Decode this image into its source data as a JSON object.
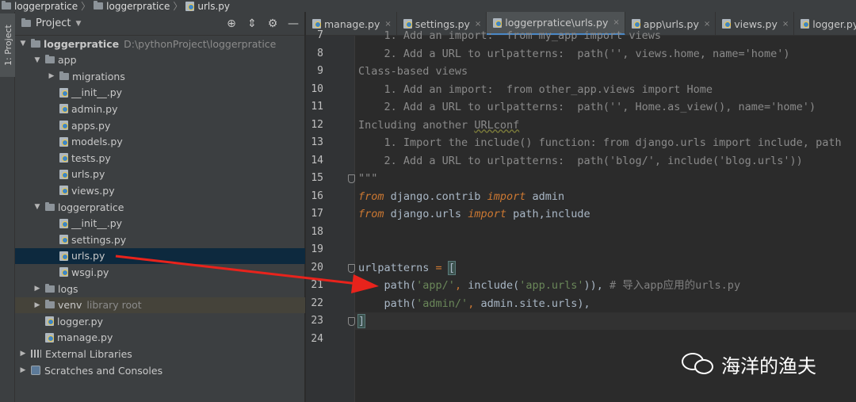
{
  "breadcrumb": [
    "loggerpratice",
    "loggerpratice",
    "urls.py"
  ],
  "tool_window_tab": "1: Project",
  "project_panel": {
    "title": "Project",
    "tree": [
      {
        "label": "loggerpratice",
        "hint": "D:\\pythonProject\\loggerpratice",
        "depth": 0,
        "type": "folder",
        "expanded": true,
        "bold": true
      },
      {
        "label": "app",
        "depth": 1,
        "type": "folder",
        "expanded": true
      },
      {
        "label": "migrations",
        "depth": 2,
        "type": "folder",
        "expanded": false
      },
      {
        "label": "__init__.py",
        "depth": 2,
        "type": "py"
      },
      {
        "label": "admin.py",
        "depth": 2,
        "type": "py"
      },
      {
        "label": "apps.py",
        "depth": 2,
        "type": "py"
      },
      {
        "label": "models.py",
        "depth": 2,
        "type": "py"
      },
      {
        "label": "tests.py",
        "depth": 2,
        "type": "py"
      },
      {
        "label": "urls.py",
        "depth": 2,
        "type": "py"
      },
      {
        "label": "views.py",
        "depth": 2,
        "type": "py"
      },
      {
        "label": "loggerpratice",
        "depth": 1,
        "type": "folder",
        "expanded": true
      },
      {
        "label": "__init__.py",
        "depth": 2,
        "type": "py"
      },
      {
        "label": "settings.py",
        "depth": 2,
        "type": "py"
      },
      {
        "label": "urls.py",
        "depth": 2,
        "type": "py",
        "selected": true
      },
      {
        "label": "wsgi.py",
        "depth": 2,
        "type": "py"
      },
      {
        "label": "logs",
        "depth": 1,
        "type": "folder",
        "expanded": false
      },
      {
        "label": "venv",
        "hint": "library root",
        "depth": 1,
        "type": "folder",
        "expanded": false,
        "libroot": true
      },
      {
        "label": "logger.py",
        "depth": 1,
        "type": "py"
      },
      {
        "label": "manage.py",
        "depth": 1,
        "type": "py"
      },
      {
        "label": "External Libraries",
        "depth": 0,
        "type": "ext",
        "expanded": false
      },
      {
        "label": "Scratches and Consoles",
        "depth": 0,
        "type": "scratch",
        "expanded": false
      }
    ]
  },
  "tabs": [
    {
      "label": "manage.py",
      "active": false
    },
    {
      "label": "settings.py",
      "active": false
    },
    {
      "label": "loggerpratice\\urls.py",
      "active": true
    },
    {
      "label": "app\\urls.py",
      "active": false
    },
    {
      "label": "views.py",
      "active": false
    },
    {
      "label": "logger.py",
      "active": false
    }
  ],
  "editor": {
    "first_line_number": 7,
    "highlight_line": 23,
    "lines": [
      {
        "n": 7,
        "parts": [
          {
            "t": "    1. Add an import:  from my_app import views",
            "c": "docg"
          }
        ]
      },
      {
        "n": 8,
        "parts": [
          {
            "t": "    2. Add a URL to urlpatterns:  path('', views.home, name='home')",
            "c": "docg"
          }
        ]
      },
      {
        "n": 9,
        "parts": [
          {
            "t": "Class-based views",
            "c": "docg"
          }
        ]
      },
      {
        "n": 10,
        "parts": [
          {
            "t": "    1. Add an import:  from other_app.views import Home",
            "c": "docg"
          }
        ]
      },
      {
        "n": 11,
        "parts": [
          {
            "t": "    2. Add a URL to urlpatterns:  path('', Home.as_view(), name='home')",
            "c": "docg"
          }
        ]
      },
      {
        "n": 12,
        "parts": [
          {
            "t": "Including another ",
            "c": "docg"
          },
          {
            "t": "URLconf",
            "c": "docg ul"
          }
        ]
      },
      {
        "n": 13,
        "parts": [
          {
            "t": "    1. Import the include() function: from django.urls import include, path",
            "c": "docg"
          }
        ]
      },
      {
        "n": 14,
        "parts": [
          {
            "t": "    2. Add a URL to urlpatterns:  path('blog/', include('blog.urls'))",
            "c": "docg"
          }
        ]
      },
      {
        "n": 15,
        "parts": [
          {
            "t": "\"\"\"",
            "c": "docg"
          }
        ]
      },
      {
        "n": 16,
        "parts": [
          {
            "t": "from",
            "c": "kw"
          },
          {
            "t": " django.contrib ",
            "c": ""
          },
          {
            "t": "import",
            "c": "kw"
          },
          {
            "t": " admin",
            "c": ""
          }
        ]
      },
      {
        "n": 17,
        "parts": [
          {
            "t": "from",
            "c": "kw"
          },
          {
            "t": " django.urls ",
            "c": ""
          },
          {
            "t": "import",
            "c": "kw"
          },
          {
            "t": " path,include",
            "c": ""
          }
        ]
      },
      {
        "n": 18,
        "parts": []
      },
      {
        "n": 19,
        "parts": []
      },
      {
        "n": 20,
        "parts": [
          {
            "t": "urlpatterns ",
            "c": ""
          },
          {
            "t": "=",
            "c": "op"
          },
          {
            "t": " ",
            "c": ""
          },
          {
            "t": "[",
            "c": "brk"
          }
        ]
      },
      {
        "n": 21,
        "parts": [
          {
            "t": "    path(",
            "c": ""
          },
          {
            "t": "'app/'",
            "c": "str"
          },
          {
            "t": ", ",
            "c": "op"
          },
          {
            "t": "include(",
            "c": ""
          },
          {
            "t": "'app.urls'",
            "c": "str"
          },
          {
            "t": ")),",
            "c": ""
          },
          {
            "t": " # 导入app应用的urls.py",
            "c": "cmt"
          }
        ]
      },
      {
        "n": 22,
        "parts": [
          {
            "t": "    path(",
            "c": ""
          },
          {
            "t": "'admin/'",
            "c": "str"
          },
          {
            "t": ", ",
            "c": "op"
          },
          {
            "t": "admin.site.urls),",
            "c": ""
          }
        ]
      },
      {
        "n": 23,
        "parts": [
          {
            "t": "]",
            "c": "brk"
          }
        ]
      },
      {
        "n": 24,
        "parts": []
      }
    ]
  },
  "watermark": "海洋的渔夫",
  "colors": {
    "arrow": "#e8231c",
    "selection": "#0d293e",
    "active_tab_underline": "#4a88c7"
  }
}
